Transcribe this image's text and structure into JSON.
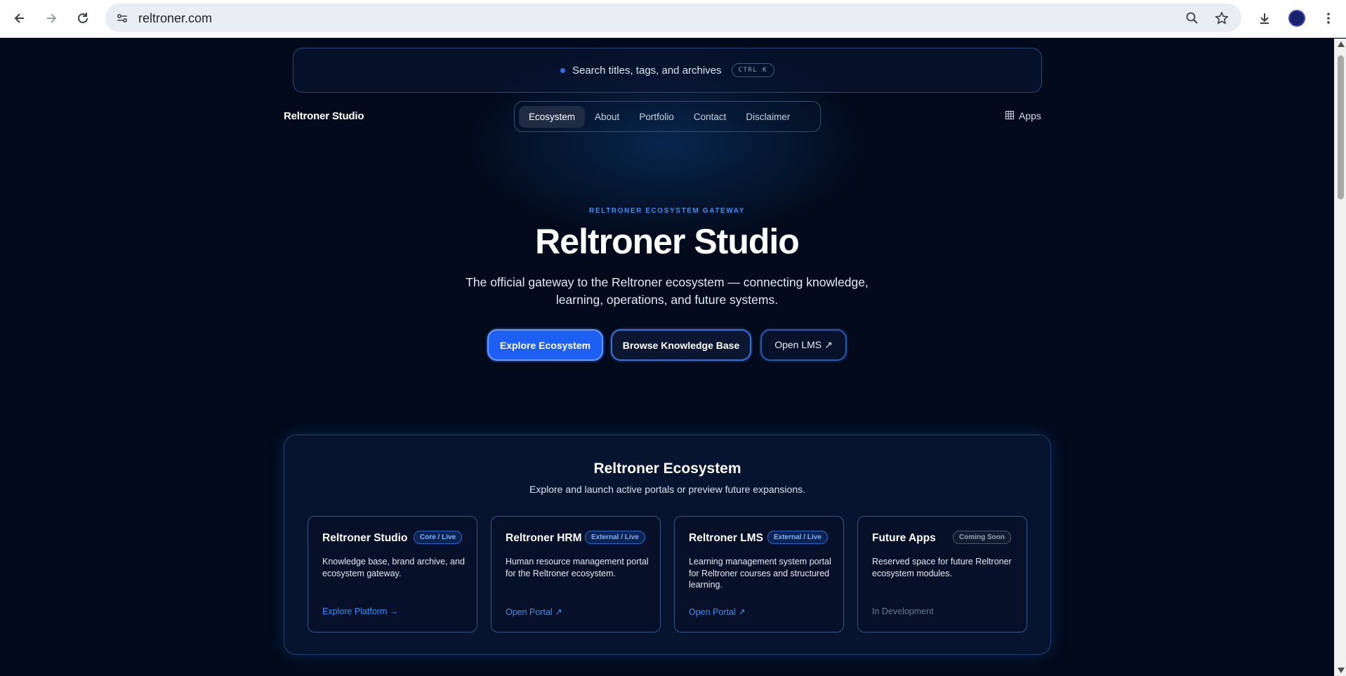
{
  "browser": {
    "url": "reltroner.com"
  },
  "search": {
    "placeholder": "Search titles, tags, and archives",
    "shortcut": "CTRL K"
  },
  "header": {
    "brand": "Reltroner Studio",
    "nav": [
      {
        "label": "Ecosystem",
        "active": true
      },
      {
        "label": "About",
        "active": false
      },
      {
        "label": "Portfolio",
        "active": false
      },
      {
        "label": "Contact",
        "active": false
      },
      {
        "label": "Disclaimer",
        "active": false
      }
    ],
    "apps_label": "Apps"
  },
  "hero": {
    "eyebrow": "RELTRONER ECOSYSTEM GATEWAY",
    "title": "Reltroner Studio",
    "subtitle": "The official gateway to the Reltroner ecosystem — connecting knowledge, learning, operations, and future systems.",
    "buttons": {
      "primary": "Explore Ecosystem",
      "secondary": "Browse Knowledge Base",
      "tertiary": "Open LMS ↗"
    }
  },
  "ecosystem": {
    "title": "Reltroner Ecosystem",
    "subtitle": "Explore and launch active portals or preview future expansions.",
    "cards": [
      {
        "title": "Reltroner Studio",
        "badge": "Core / Live",
        "desc": "Knowledge base, brand archive, and ecosystem gateway.",
        "link": "Explore Platform →"
      },
      {
        "title": "Reltroner HRM",
        "badge": "External / Live",
        "desc": "Human resource management portal for the Reltroner ecosystem.",
        "link": "Open Portal ↗"
      },
      {
        "title": "Reltroner LMS",
        "badge": "External / Live",
        "desc": "Learning management system portal for Reltroner courses and structured learning.",
        "link": "Open Portal ↗"
      },
      {
        "title": "Future Apps",
        "badge": "Coming Soon",
        "desc": "Reserved space for future Reltroner ecosystem modules.",
        "link": "In Development"
      }
    ]
  },
  "colors": {
    "accent": "#1d5ff2",
    "link": "#3f8ef2",
    "background": "#020a1b"
  }
}
